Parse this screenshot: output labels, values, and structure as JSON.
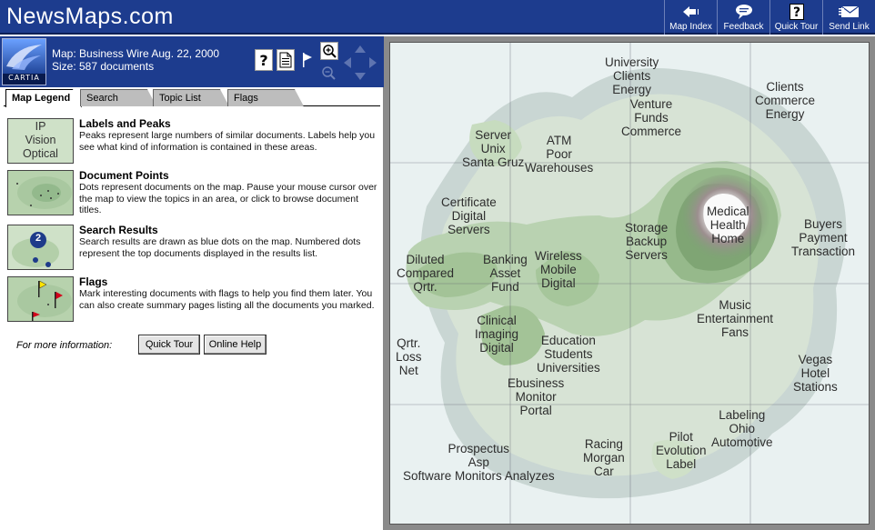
{
  "header": {
    "title": "NewsMaps.com"
  },
  "nav": [
    {
      "label": "Map Index",
      "icon": "arrow-left-icon"
    },
    {
      "label": "Feedback",
      "icon": "speech-bubble-icon"
    },
    {
      "label": "Quick Tour",
      "icon": "help-icon"
    },
    {
      "label": "Send Link",
      "icon": "envelope-icon"
    }
  ],
  "info": {
    "brand": "CARTIA",
    "map_line": "Map: Business Wire Aug. 22, 2000",
    "size_line": "Size: 587 documents"
  },
  "tabs": [
    "Map Legend",
    "Search",
    "Topic List",
    "Flags"
  ],
  "legend": [
    {
      "title": "Labels and Peaks",
      "desc": "Peaks represent large numbers of similar documents. Labels help you see what kind of information is contained in these areas.",
      "thumb_words": [
        "IP",
        "Vision",
        "Optical"
      ]
    },
    {
      "title": "Document Points",
      "desc": "Dots represent documents on the map. Pause your mouse cursor over the map to view the topics in an area, or click to browse document titles."
    },
    {
      "title": "Search Results",
      "desc": "Search results are drawn as blue dots on the map. Numbered dots represent the top documents displayed in the results list.",
      "thumb_number": "2"
    },
    {
      "title": "Flags",
      "desc": "Mark interesting documents with flags to help you find them later. You can also create summary pages listing all the documents you marked."
    }
  ],
  "more_info": {
    "label": "For more information:",
    "quick_tour": "Quick Tour",
    "online_help": "Online Help"
  },
  "map_labels": [
    [
      "University",
      "Clients",
      "Energy"
    ],
    [
      "Venture",
      "Funds",
      "Commerce"
    ],
    [
      "Clients",
      "Commerce",
      "Energy"
    ],
    [
      "Server",
      "Unix",
      "Santa Gruz"
    ],
    [
      "ATM",
      "Poor",
      "Warehouses"
    ],
    [
      "Certificate",
      "Digital",
      "Servers"
    ],
    [
      "Medical",
      "Health",
      "Home"
    ],
    [
      "Storage",
      "Backup",
      "Servers"
    ],
    [
      "Buyers",
      "Payment",
      "Transaction"
    ],
    [
      "Diluted",
      "Compared",
      "Qrtr."
    ],
    [
      "Banking",
      "Asset",
      "Fund"
    ],
    [
      "Wireless",
      "Mobile",
      "Digital"
    ],
    [
      "Music",
      "Entertainment",
      "Fans"
    ],
    [
      "Clinical",
      "Imaging",
      "Digital"
    ],
    [
      "Qrtr.",
      "Loss",
      "Net"
    ],
    [
      "Education",
      "Students",
      "Universities"
    ],
    [
      "Vegas",
      "Hotel",
      "Stations"
    ],
    [
      "Ebusiness",
      "Monitor",
      "Portal"
    ],
    [
      "Labeling",
      "Ohio",
      "Automotive"
    ],
    [
      "Pilot",
      "Evolution",
      "Label"
    ],
    [
      "Racing",
      "Morgan",
      "Car"
    ],
    [
      "Prospectus",
      "Asp",
      "Software Monitors Analyzes"
    ]
  ]
}
